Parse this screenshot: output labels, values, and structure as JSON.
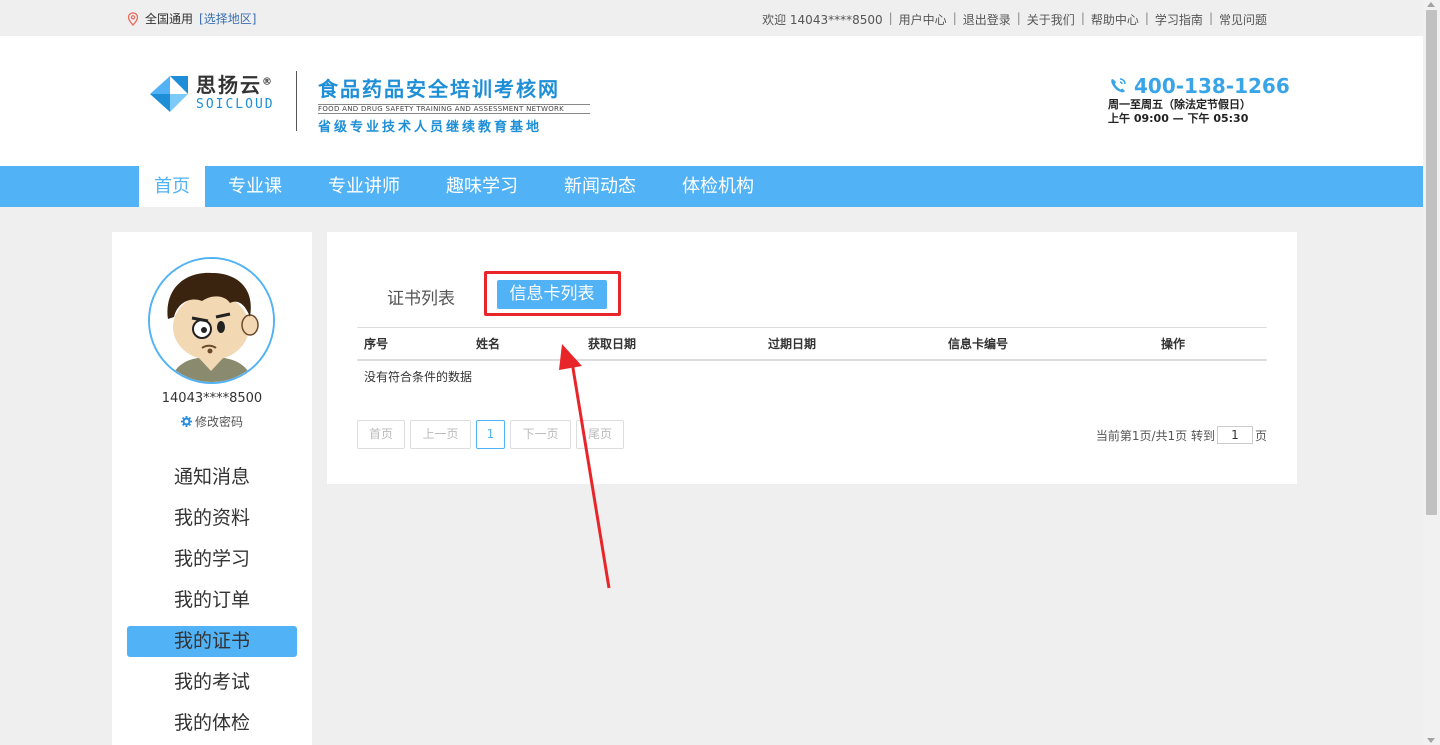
{
  "topbar": {
    "region": "全国通用",
    "select_region": "[选择地区]",
    "welcome": "欢迎 14043****8500",
    "links": [
      "用户中心",
      "退出登录",
      "关于我们",
      "帮助中心",
      "学习指南",
      "常见问题"
    ]
  },
  "header": {
    "logo_cn": "思扬云",
    "logo_reg": "®",
    "logo_en": "SOICLOUD",
    "site_title": "食品药品安全培训考核网",
    "site_title_en": "FOOD AND DRUG SAFETY TRAINING AND ASSESSMENT NETWORK",
    "site_subtitle": "省级专业技术人员继续教育基地",
    "phone": "400-138-1266",
    "hours_1": "周一至周五（除法定节假日）",
    "hours_2": "上午 09:00 — 下午 05:30"
  },
  "nav": {
    "items": [
      "首页",
      "专业课",
      "专业讲师",
      "趣味学习",
      "新闻动态",
      "体检机构"
    ],
    "active_index": 0
  },
  "sidebar": {
    "user_id": "14043****8500",
    "change_password": "修改密码",
    "menu": [
      "通知消息",
      "我的资料",
      "我的学习",
      "我的订单",
      "我的证书",
      "我的考试",
      "我的体检"
    ],
    "active_index": 4
  },
  "main": {
    "tabs": {
      "cert_list": "证书列表",
      "info_card_list": "信息卡列表"
    },
    "table": {
      "columns": [
        "序号",
        "姓名",
        "获取日期",
        "过期日期",
        "信息卡编号",
        "操作"
      ],
      "empty_message": "没有符合条件的数据"
    },
    "pager": {
      "first": "首页",
      "prev": "上一页",
      "current": "1",
      "next": "下一页",
      "last": "尾页",
      "info": "当前第1页/共1页 转到",
      "goto_value": "1",
      "page_suffix": "页"
    }
  },
  "colors": {
    "accent": "#52b2f6",
    "highlight": "#e8262a"
  }
}
